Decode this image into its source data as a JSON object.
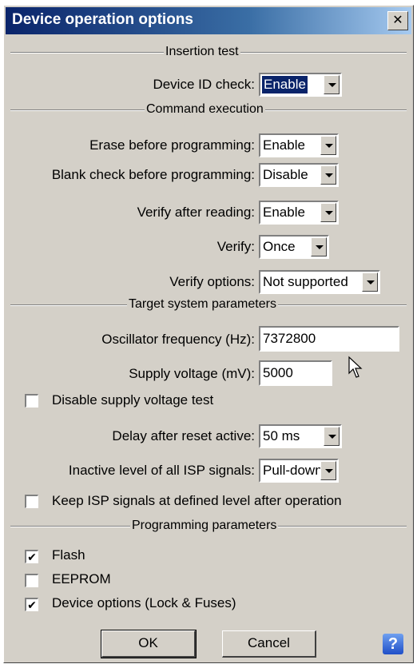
{
  "dialog": {
    "title": "Device operation options",
    "close_glyph": "✕"
  },
  "sections": {
    "insertion_test": "Insertion test",
    "command_execution": "Command execution",
    "target_system": "Target system parameters",
    "programming": "Programming parameters"
  },
  "device_id_check": {
    "label": "Device ID check:",
    "value": "Enable"
  },
  "erase_before": {
    "label": "Erase before programming:",
    "value": "Enable"
  },
  "blank_check": {
    "label": "Blank check before programming:",
    "value": "Disable"
  },
  "verify_after_reading": {
    "label": "Verify after reading:",
    "value": "Enable"
  },
  "verify": {
    "label": "Verify:",
    "value": "Once"
  },
  "verify_options": {
    "label": "Verify options:",
    "value": "Not supported"
  },
  "oscillator": {
    "label": "Oscillator frequency (Hz):",
    "value": "7372800"
  },
  "supply_voltage": {
    "label": "Supply voltage (mV):",
    "value": "5000"
  },
  "disable_supply_test": {
    "label": "Disable supply voltage test",
    "checked": false
  },
  "delay_reset": {
    "label": "Delay after reset active:",
    "value": "50 ms"
  },
  "inactive_level": {
    "label": "Inactive level of all ISP signals:",
    "value": "Pull-down"
  },
  "keep_isp": {
    "label": "Keep ISP signals at defined level after operation",
    "checked": false
  },
  "flash": {
    "label": "Flash",
    "checked": true
  },
  "eeprom": {
    "label": "EEPROM",
    "checked": false
  },
  "device_options": {
    "label": "Device options (Lock & Fuses)",
    "checked": true
  },
  "buttons": {
    "ok": "OK",
    "cancel": "Cancel",
    "help": "?"
  },
  "icons": {
    "checkmark": "✔",
    "close": "close-icon",
    "help": "help-icon",
    "cursor": "mouse-pointer-icon"
  }
}
